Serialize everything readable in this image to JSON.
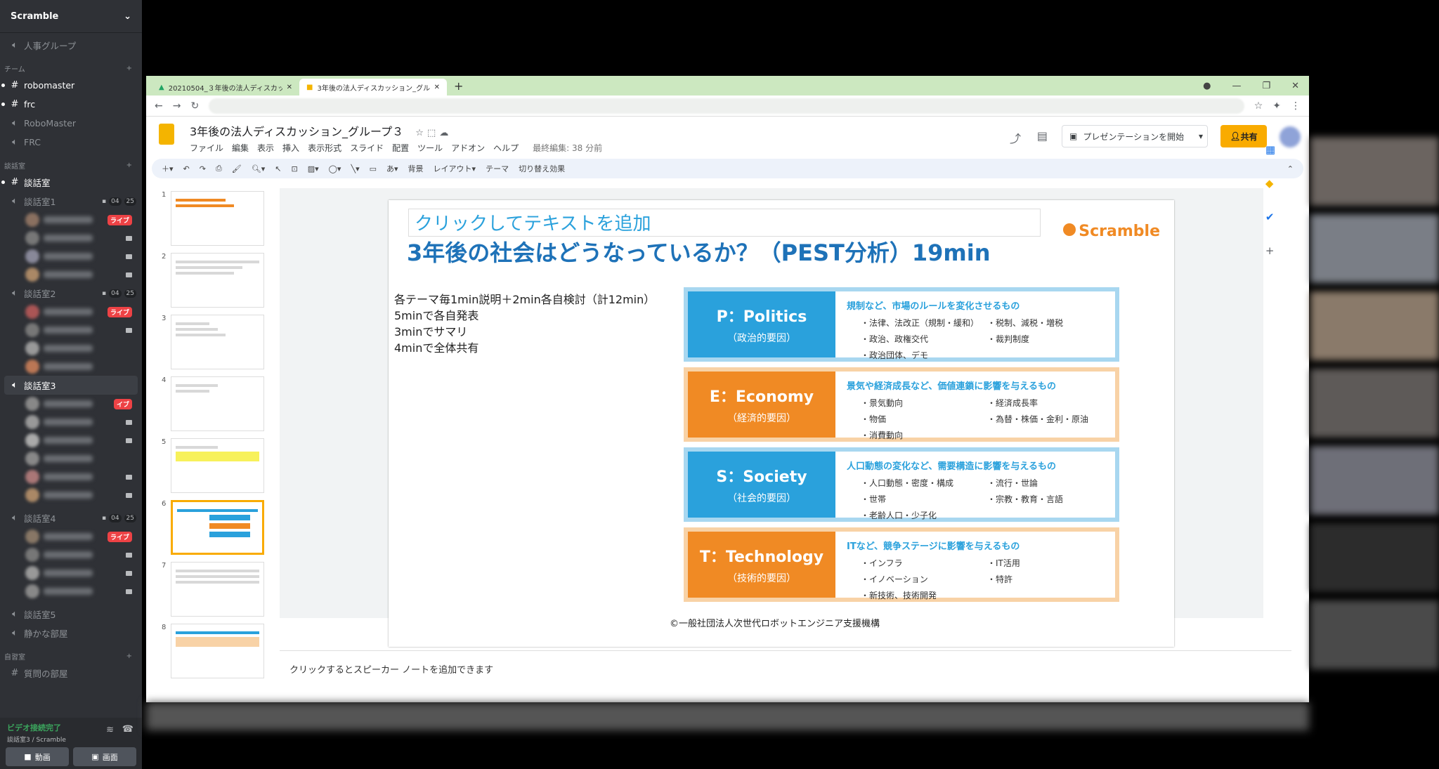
{
  "discord": {
    "server": "Scramble",
    "top_channel": "人事グループ",
    "cat_team": "チーム",
    "team_channels": [
      "robomaster",
      "frc"
    ],
    "team_voice": [
      "RoboMaster",
      "FRC"
    ],
    "cat_talk": "談話室",
    "text_talk": "談話室",
    "rooms": [
      {
        "name": "談話室1",
        "count": "04",
        "limit": "25"
      },
      {
        "name": "談話室2",
        "count": "04",
        "limit": "25"
      },
      {
        "name": "談話室3"
      },
      {
        "name": "談話室4",
        "count": "04",
        "limit": "25"
      },
      {
        "name": "談話室5"
      },
      {
        "name": "静かな部屋"
      }
    ],
    "live": "ライブ",
    "live_partial": "イブ",
    "cat_self": "自習室",
    "question_channel": "質問の部屋",
    "voice_status": "ビデオ接続完了",
    "voice_location": "談話室3 / Scramble",
    "btn_video": "動画",
    "btn_screen": "画面"
  },
  "browser": {
    "tabs": [
      "20210504_３年後の法人ディスカッ",
      "3年後の法人ディスカッション_グルー"
    ],
    "doc_title": "3年後の法人ディスカッション_グループ３",
    "menu": [
      "ファイル",
      "編集",
      "表示",
      "挿入",
      "表示形式",
      "スライド",
      "配置",
      "ツール",
      "アドオン",
      "ヘルプ"
    ],
    "last_edit": "最終編集: 38 分前",
    "present_btn": "プレゼンテーションを開始",
    "share_btn": "共有",
    "toolbar": [
      "背景",
      "レイアウト▾",
      "テーマ",
      "切り替え効果"
    ],
    "notes_placeholder": "クリックするとスピーカー ノートを追加できます"
  },
  "slide": {
    "placeholder": "クリックしてテキストを追加",
    "title": "3年後の社会はどうなっているか？（PEST分析）19min",
    "brand": "Scramble",
    "body": [
      "各テーマ毎1min説明＋2min各自検討（計12min）",
      "5minで各自発表",
      "3minでサマリ",
      "4minで全体共有"
    ],
    "copyright": "©一般社団法人次世代ロボットエンジニア支援機構",
    "pest": [
      {
        "en": "P：Politics",
        "jp": "（政治的要因）",
        "desc": "規制など、市場のルールを変化させるもの",
        "items": [
          "・法律、法改正（規制・緩和）",
          "・税制、減税・増税",
          "・政治、政権交代",
          "・裁判制度",
          "・政治団体、デモ",
          ""
        ],
        "color": "#2aa1dc"
      },
      {
        "en": "E：Economy",
        "jp": "（経済的要因）",
        "desc": "景気や経済成長など、価値連鎖に影響を与えるもの",
        "items": [
          "・景気動向",
          "・経済成長率",
          "・物価",
          "・為替・株価・金利・原油",
          "・消費動向",
          ""
        ],
        "color": "#f08a24"
      },
      {
        "en": "S：Society",
        "jp": "（社会的要因）",
        "desc": "人口動態の変化など、需要構造に影響を与えるもの",
        "items": [
          "・人口動態・密度・構成",
          "・流行・世論",
          "・世帯",
          "・宗教・教育・言語",
          "・老齢人口・少子化",
          ""
        ],
        "color": "#2aa1dc"
      },
      {
        "en": "T：Technology",
        "jp": "（技術的要因）",
        "desc": "ITなど、競争ステージに影響を与えるもの",
        "items": [
          "・インフラ",
          "・IT活用",
          "・イノベーション",
          "・特許",
          "・新技術、技術開発",
          ""
        ],
        "color": "#f08a24"
      }
    ]
  },
  "thumb_numbers": [
    "1",
    "2",
    "3",
    "4",
    "5",
    "6",
    "7",
    "8"
  ]
}
